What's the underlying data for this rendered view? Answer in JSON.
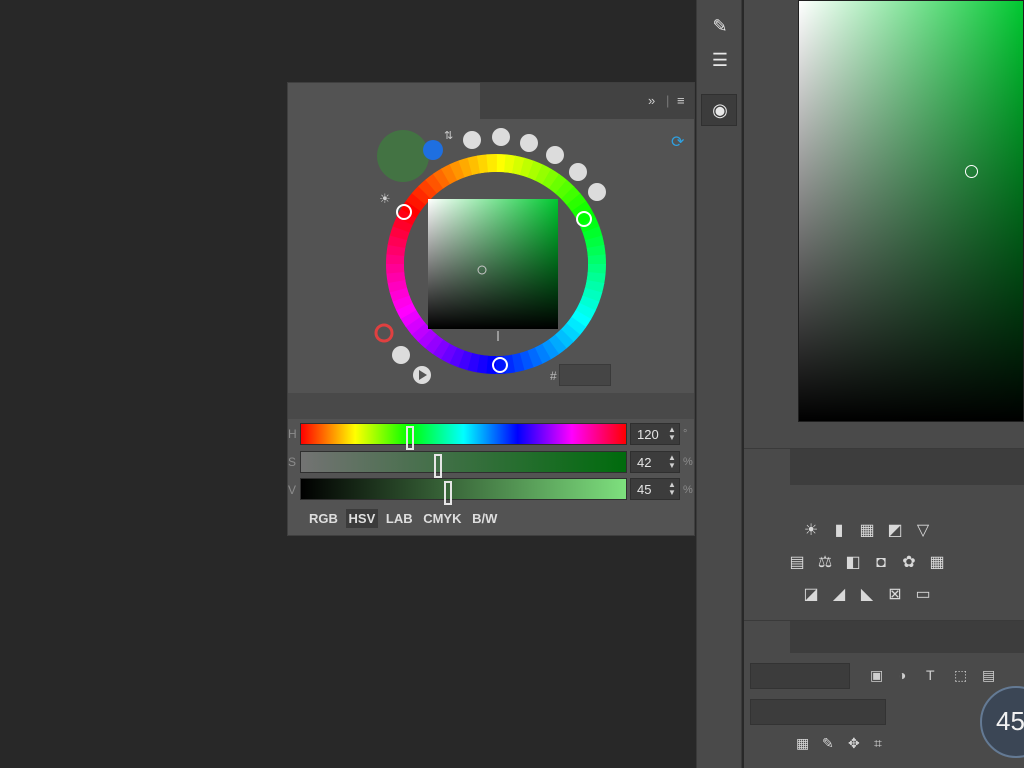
{
  "panel": {
    "title": "",
    "tab_icons": {
      "expand": "double-chevron-right-icon",
      "separator": "|",
      "menu": "hamburger-menu-icon"
    },
    "refresh_icon": "refresh-icon",
    "hex": {
      "hash": "#",
      "value": ""
    },
    "slider_tabs": [
      "",
      ""
    ],
    "sliders": [
      {
        "label": "H",
        "value": "120",
        "unit": "°",
        "fraction": 0.333
      },
      {
        "label": "S",
        "value": "42",
        "unit": "%",
        "fraction": 0.42
      },
      {
        "label": "V",
        "value": "45",
        "unit": "%",
        "fraction": 0.45
      }
    ],
    "modes": {
      "label": "",
      "items": [
        "RGB",
        "HSV",
        "LAB",
        "CMYK",
        "B/W"
      ],
      "active": "HSV"
    }
  },
  "colors": {
    "current": "#437343",
    "accent": "#1e6fe0",
    "panel_bg": "#535353",
    "app_bg": "#282828"
  },
  "photoshop": {
    "adjustments": {
      "tab": "",
      "add_label": ""
    },
    "layers": {
      "tabs": [
        "",
        "",
        ""
      ],
      "filter_placeholder": "",
      "blend_mode": "",
      "opacity_label": "",
      "lock_label": ""
    },
    "badge": "45"
  },
  "watermark": ""
}
